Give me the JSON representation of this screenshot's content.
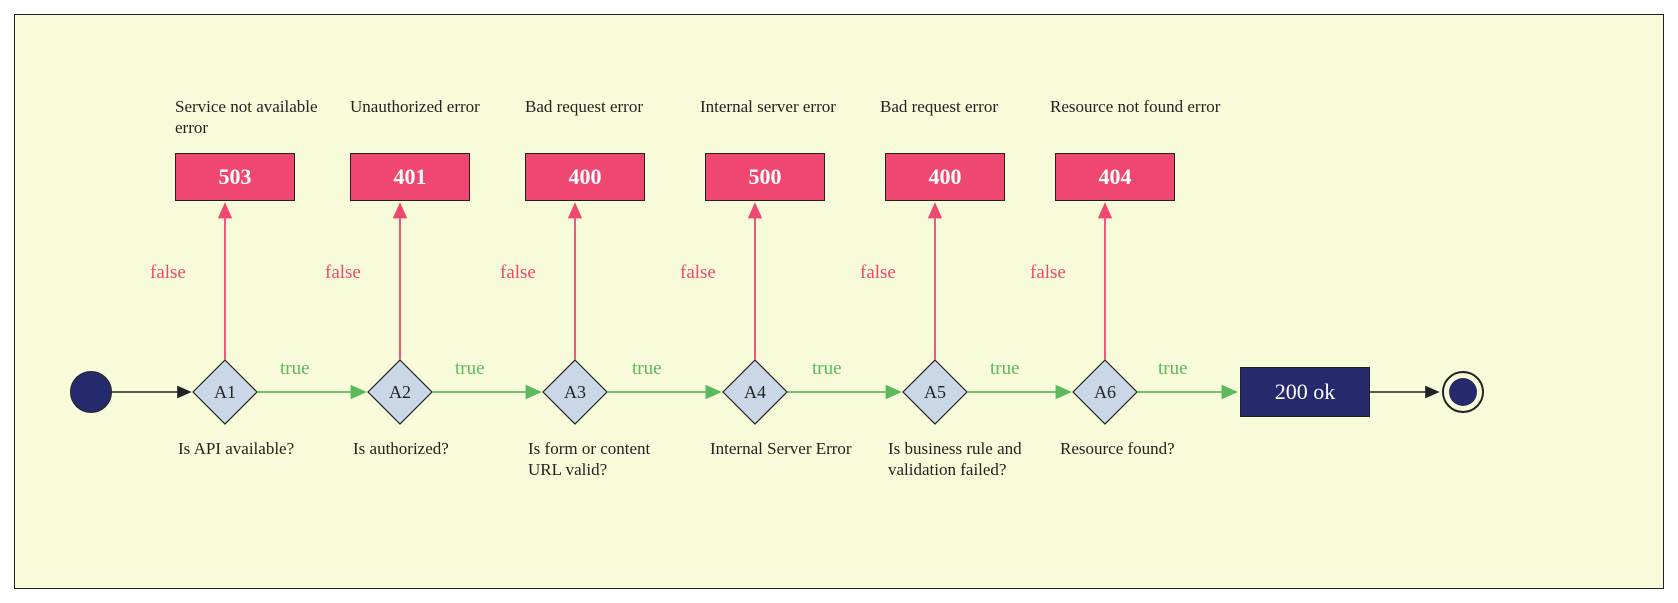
{
  "diagram": {
    "nodes": [
      {
        "id": "A1",
        "question": "Is API available?"
      },
      {
        "id": "A2",
        "question": "Is authorized?"
      },
      {
        "id": "A3",
        "question": "Is form or content URL valid?"
      },
      {
        "id": "A4",
        "question": "Internal Server Error"
      },
      {
        "id": "A5",
        "question": "Is business rule and validation failed?"
      },
      {
        "id": "A6",
        "question": "Resource found?"
      }
    ],
    "errors": [
      {
        "code": "503",
        "label": "Service not available error"
      },
      {
        "code": "401",
        "label": "Unauthorized error"
      },
      {
        "code": "400",
        "label": "Bad request error"
      },
      {
        "code": "500",
        "label": "Internal server error"
      },
      {
        "code": "400",
        "label": "Bad request error"
      },
      {
        "code": "404",
        "label": "Resource not found error"
      }
    ],
    "edge_true_label": "true",
    "edge_false_label": "false",
    "success_label": "200 ok"
  },
  "colors": {
    "error_fill": "#ef476f",
    "success_fill": "#27296d",
    "decision_fill": "#c9d7e6",
    "true_color": "#5cb85c",
    "false_color": "#ef476f",
    "canvas_bg": "#f8fbd9"
  }
}
